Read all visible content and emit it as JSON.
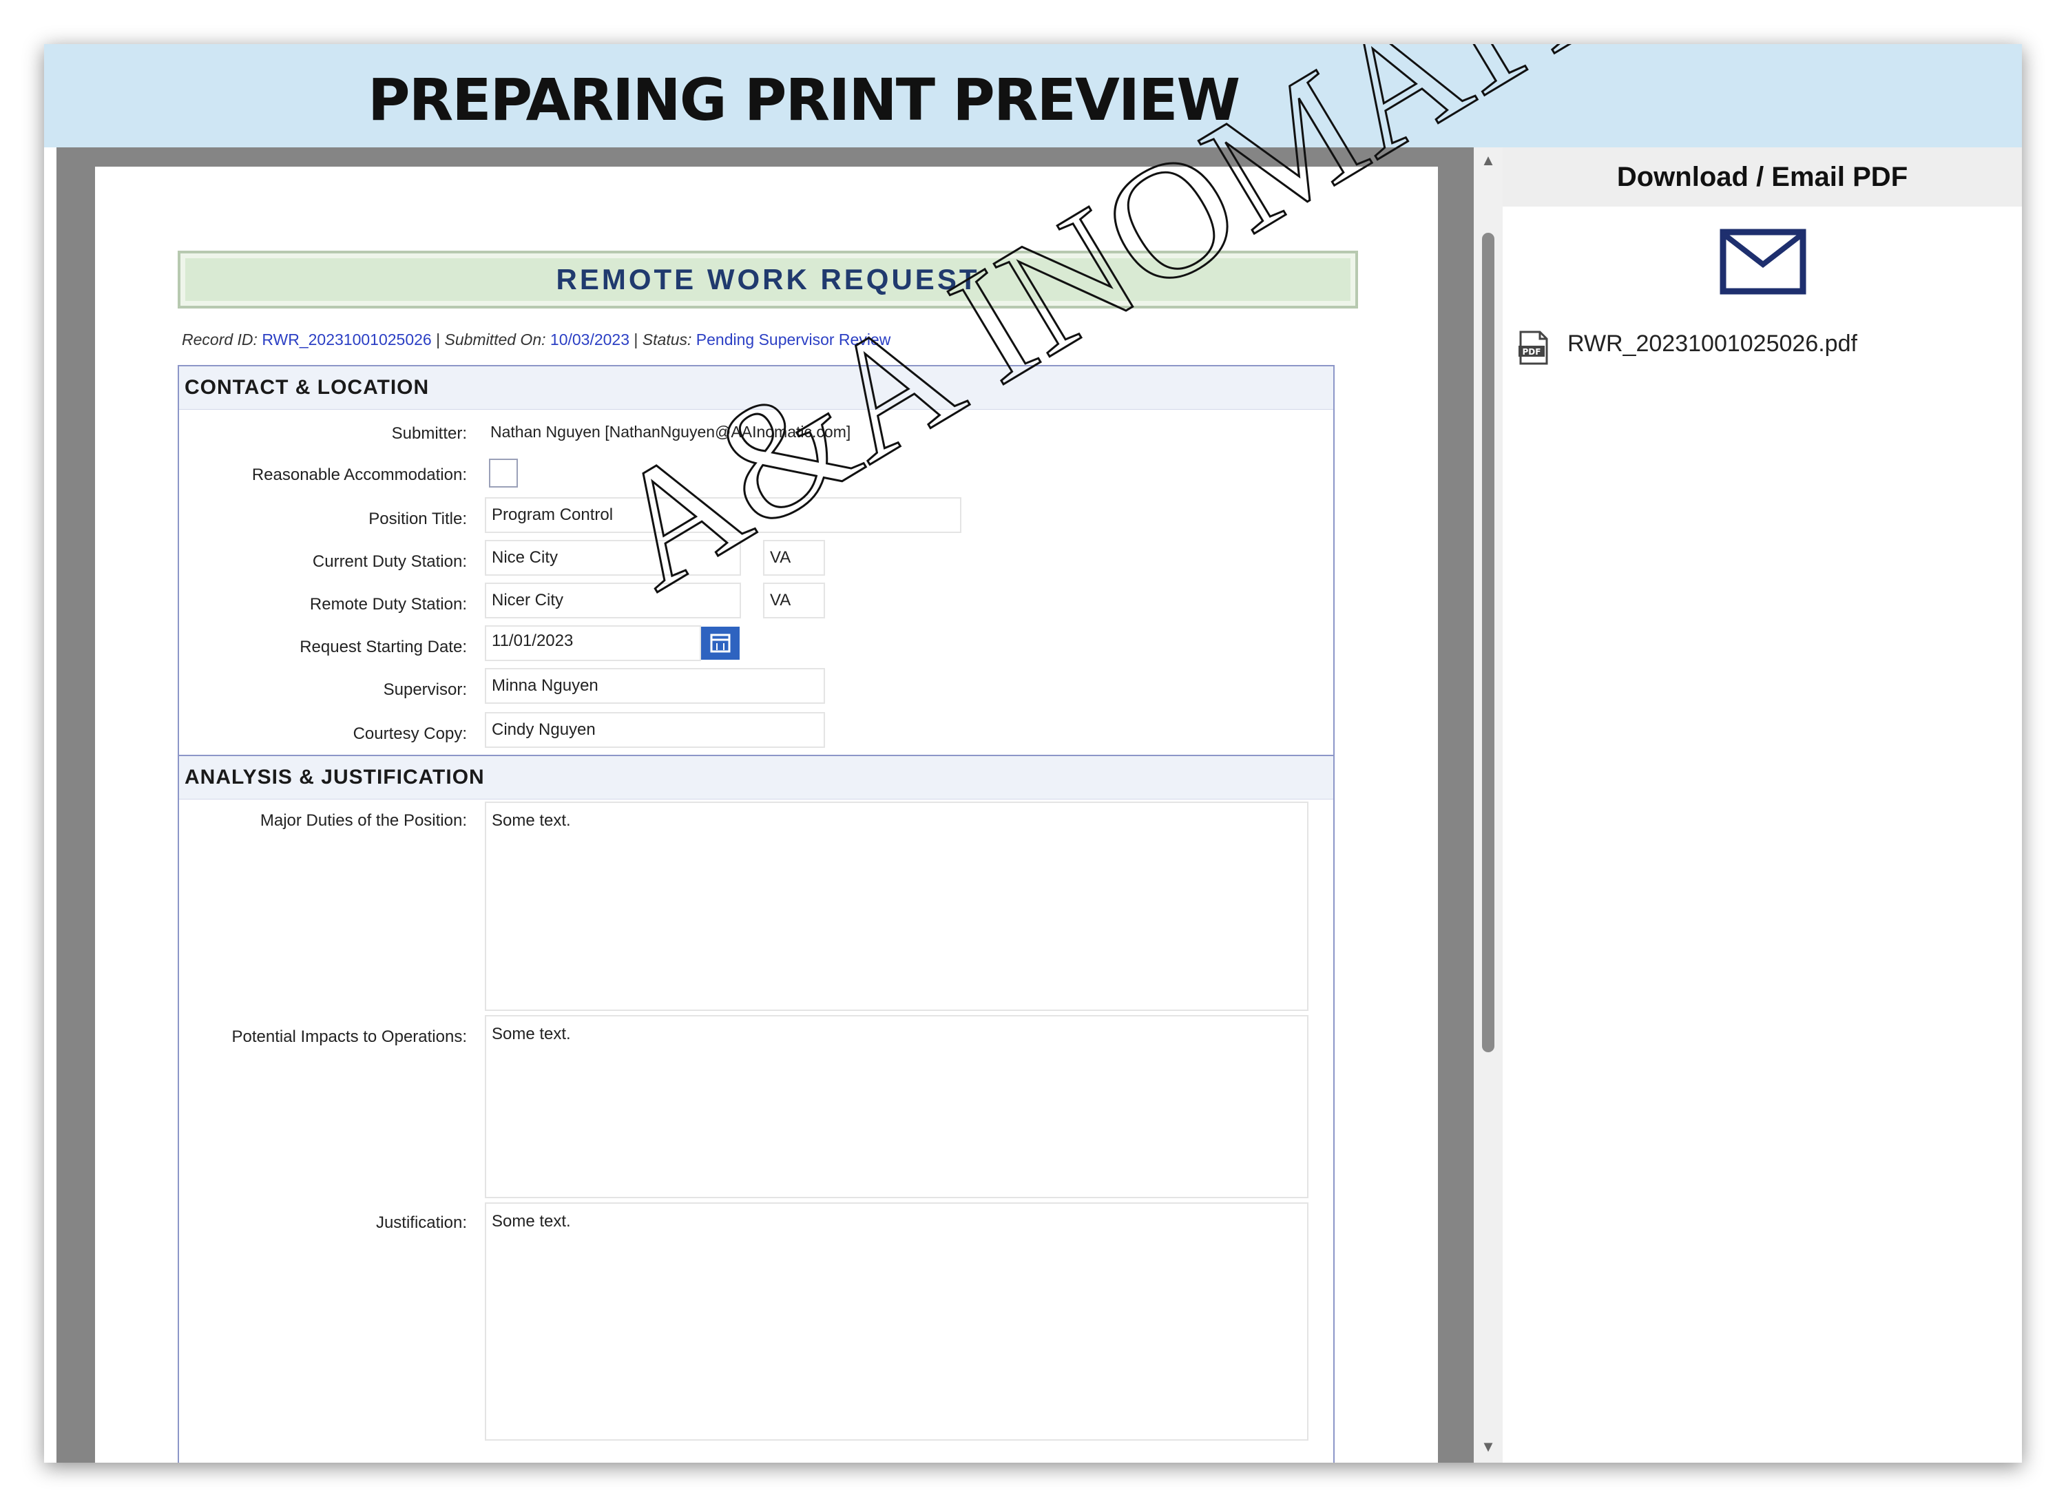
{
  "banner": {
    "title": "PREPARING PRINT PREVIEW"
  },
  "form": {
    "title": "REMOTE WORK REQUEST",
    "meta": {
      "record_id_label": "Record ID:",
      "record_id": "RWR_20231001025026",
      "submitted_label": "Submitted On:",
      "submitted": "10/03/2023",
      "status_label": "Status:",
      "status": "Pending Supervisor Review",
      "separator": "|"
    },
    "contact": {
      "heading": "CONTACT & LOCATION",
      "submitter_label": "Submitter:",
      "submitter": "Nathan Nguyen [NathanNguyen@AAInomatic.com]",
      "accommodation_label": "Reasonable Accommodation:",
      "position_label": "Position Title:",
      "position": "Program Control",
      "current_station_label": "Current Duty Station:",
      "current_city": "Nice City",
      "current_state": "VA",
      "remote_station_label": "Remote Duty Station:",
      "remote_city": "Nicer City",
      "remote_state": "VA",
      "start_date_label": "Request Starting Date:",
      "start_date": "11/01/2023",
      "supervisor_label": "Supervisor:",
      "supervisor": "Minna Nguyen",
      "courtesy_label": "Courtesy Copy:",
      "courtesy": "Cindy Nguyen"
    },
    "analysis": {
      "heading": "ANALYSIS & JUSTIFICATION",
      "duties_label": "Major Duties of the Position:",
      "duties": "Some text.",
      "impacts_label": "Potential Impacts to Operations:",
      "impacts": "Some text.",
      "justification_label": "Justification:",
      "justification": "Some text."
    }
  },
  "side_panel": {
    "header": "Download / Email PDF",
    "file_name": "RWR_20231001025026.pdf",
    "icons": [
      "mail-icon",
      "pdf-file-icon",
      "calendar-icon"
    ]
  },
  "watermark": {
    "text": "A&A INOMATIC, LLC."
  },
  "colors": {
    "banner": "#cfe6f4",
    "title_bar": "#d9ead3",
    "title_text": "#203a6e",
    "meta_value": "#2b3fc4",
    "calendar": "#2e63c0",
    "mail": "#1e2f6e"
  }
}
